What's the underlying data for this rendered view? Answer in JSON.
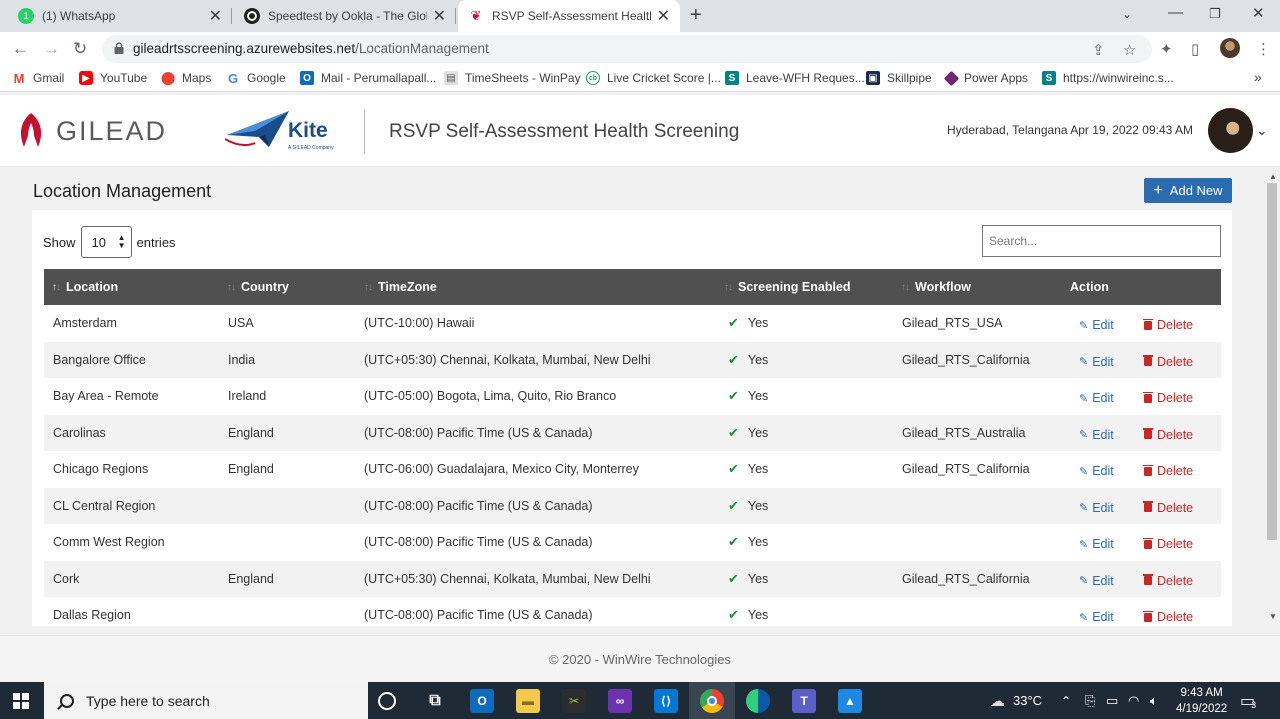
{
  "browser": {
    "tabs": [
      {
        "title": "(1) WhatsApp",
        "active": false
      },
      {
        "title": "Speedtest by Ookla - The Global",
        "active": false
      },
      {
        "title": "RSVP Self-Assessment Health Sc",
        "active": true
      }
    ],
    "url_host": "gileadrtsscreening.azurewebsites.net",
    "url_path": "/LocationManagement",
    "bookmarks": [
      "Gmail",
      "YouTube",
      "Maps",
      "Google",
      "Mail - Perumallapall...",
      "TimeSheets - WinPay",
      "Live Cricket Score |...",
      "Leave-WFH Reques...",
      "Skillpipe",
      "Power Apps",
      "https://winwireinc.s..."
    ]
  },
  "header": {
    "brand": "GILEAD",
    "kite": "Kite",
    "kite_sub": "A GILEAD Company",
    "app_title": "RSVP Self-Assessment Health Screening",
    "location_datetime": "Hyderabad, Telangana  Apr 19, 2022 09:43 AM"
  },
  "page": {
    "title": "Location Management",
    "add_button": "Add New",
    "show_label": "Show",
    "entries_label": "entries",
    "page_length": "10",
    "search_placeholder": "Search..."
  },
  "table": {
    "columns": [
      "Location",
      "Country",
      "TimeZone",
      "Screening Enabled",
      "Workflow",
      "Action"
    ],
    "edit_label": "Edit",
    "delete_label": "Delete",
    "rows": [
      {
        "location": "Amsterdam",
        "country": "USA",
        "timezone": "(UTC-10:00) Hawaii",
        "screening": "Yes",
        "workflow": "Gilead_RTS_USA"
      },
      {
        "location": "Bangalore Office",
        "country": "India",
        "timezone": "(UTC+05:30) Chennai, Kolkata, Mumbai, New Delhi",
        "screening": "Yes",
        "workflow": "Gilead_RTS_California"
      },
      {
        "location": "Bay Area - Remote",
        "country": "Ireland",
        "timezone": "(UTC-05:00) Bogota, Lima, Quito, Rio Branco",
        "screening": "Yes",
        "workflow": ""
      },
      {
        "location": "Carolinas",
        "country": "England",
        "timezone": "(UTC-08:00) Pacific Time (US & Canada)",
        "screening": "Yes",
        "workflow": "Gilead_RTS_Australia"
      },
      {
        "location": "Chicago Regions",
        "country": "England",
        "timezone": "(UTC-06:00) Guadalajara, Mexico City, Monterrey",
        "screening": "Yes",
        "workflow": "Gilead_RTS_California"
      },
      {
        "location": "CL Central Region",
        "country": "",
        "timezone": "(UTC-08:00) Pacific Time (US & Canada)",
        "screening": "Yes",
        "workflow": ""
      },
      {
        "location": "Comm West Region",
        "country": "",
        "timezone": "(UTC-08:00) Pacific Time (US & Canada)",
        "screening": "Yes",
        "workflow": ""
      },
      {
        "location": "Cork",
        "country": "England",
        "timezone": "(UTC+05:30) Chennai, Kolkata, Mumbai, New Delhi",
        "screening": "Yes",
        "workflow": "Gilead_RTS_California"
      },
      {
        "location": "Dallas Region",
        "country": "",
        "timezone": "(UTC-08:00) Pacific Time (US & Canada)",
        "screening": "Yes",
        "workflow": ""
      }
    ]
  },
  "footer": {
    "text": "© 2020 - WinWire Technologies"
  },
  "taskbar": {
    "search_placeholder": "Type here to search",
    "temperature": "33°C",
    "time": "9:43 AM",
    "date": "4/19/2022",
    "notifications": "3"
  },
  "colors": {
    "accent": "#2b6cb0",
    "header_row": "#505050",
    "delete": "#c62828",
    "check": "#1e8a3a"
  }
}
